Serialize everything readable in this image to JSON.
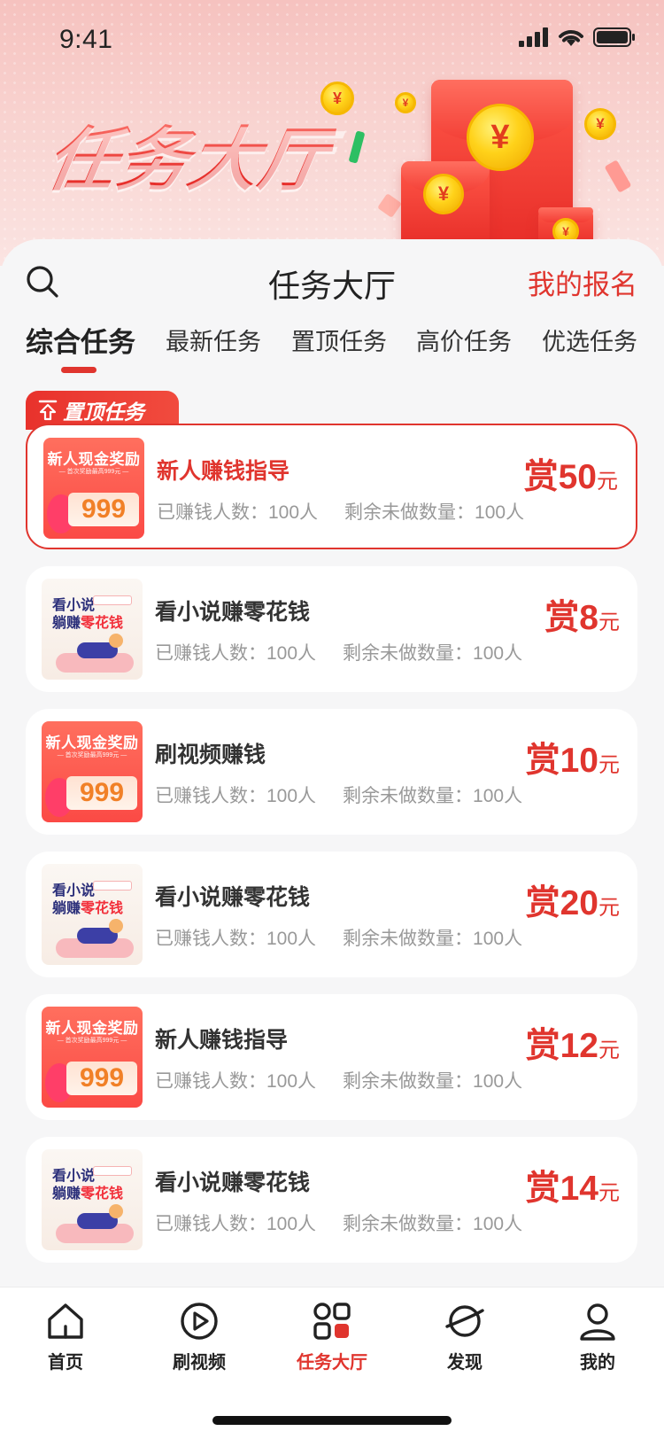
{
  "status_bar": {
    "time": "9:41"
  },
  "banner": {
    "title": "任务大厅"
  },
  "header": {
    "title": "任务大厅",
    "my_signup": "我的报名"
  },
  "tabs": [
    {
      "label": "综合任务",
      "active": true
    },
    {
      "label": "最新任务"
    },
    {
      "label": "置顶任务"
    },
    {
      "label": "高价任务"
    },
    {
      "label": "优选任务"
    }
  ],
  "pinned_tag": "置顶任务",
  "thumbnails": {
    "promo": {
      "title": "新人现金奖励",
      "subtitle": "— 首次奖励最高999元 —",
      "amount": "999"
    },
    "novel": {
      "line1": "看小说",
      "line2_a": "躺赚",
      "line2_b": "零花钱"
    }
  },
  "tasks": [
    {
      "name": "新人赚钱指导",
      "earned_label": "已赚钱人数：100人",
      "remaining_label": "剩余未做数量：100人",
      "reward_prefix": "赏",
      "reward_amount": "50",
      "reward_unit": "元",
      "thumb": "promo",
      "featured": true
    },
    {
      "name": "看小说赚零花钱",
      "earned_label": "已赚钱人数：100人",
      "remaining_label": "剩余未做数量：100人",
      "reward_prefix": "赏",
      "reward_amount": "8",
      "reward_unit": "元",
      "thumb": "novel"
    },
    {
      "name": "刷视频赚钱",
      "earned_label": "已赚钱人数：100人",
      "remaining_label": "剩余未做数量：100人",
      "reward_prefix": "赏",
      "reward_amount": "10",
      "reward_unit": "元",
      "thumb": "promo"
    },
    {
      "name": "看小说赚零花钱",
      "earned_label": "已赚钱人数：100人",
      "remaining_label": "剩余未做数量：100人",
      "reward_prefix": "赏",
      "reward_amount": "20",
      "reward_unit": "元",
      "thumb": "novel"
    },
    {
      "name": "新人赚钱指导",
      "earned_label": "已赚钱人数：100人",
      "remaining_label": "剩余未做数量：100人",
      "reward_prefix": "赏",
      "reward_amount": "12",
      "reward_unit": "元",
      "thumb": "promo"
    },
    {
      "name": "看小说赚零花钱",
      "earned_label": "已赚钱人数：100人",
      "remaining_label": "剩余未做数量：100人",
      "reward_prefix": "赏",
      "reward_amount": "14",
      "reward_unit": "元",
      "thumb": "novel"
    }
  ],
  "bottom_nav": [
    {
      "label": "首页",
      "icon": "home-icon"
    },
    {
      "label": "刷视频",
      "icon": "play-icon"
    },
    {
      "label": "任务大厅",
      "icon": "task-grid-icon",
      "active": true
    },
    {
      "label": "发现",
      "icon": "planet-icon"
    },
    {
      "label": "我的",
      "icon": "user-icon"
    }
  ],
  "colors": {
    "accent": "#e0352e",
    "background": "#f6f6f7",
    "text": "#333333",
    "muted": "#999999"
  }
}
